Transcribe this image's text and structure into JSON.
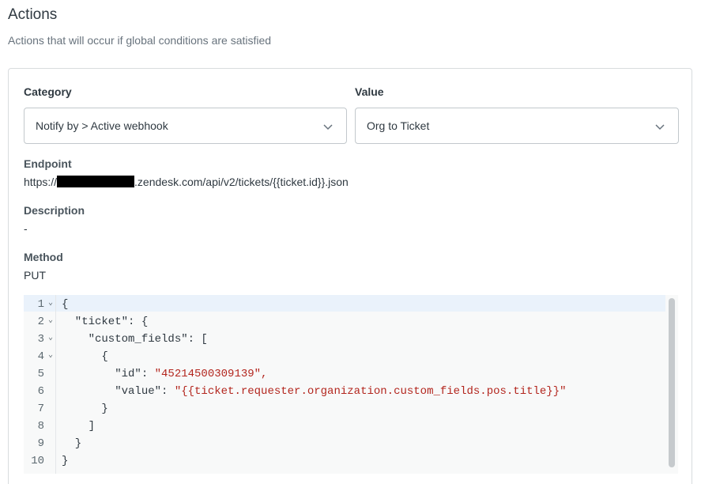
{
  "section": {
    "title": "Actions",
    "subtitle": "Actions that will occur if global conditions are satisfied"
  },
  "fields": {
    "category_label": "Category",
    "category_value": "Notify by > Active webhook",
    "value_label": "Value",
    "value_value": "Org to Ticket"
  },
  "details": {
    "endpoint_label": "Endpoint",
    "endpoint_prefix": "https://",
    "endpoint_suffix": ".zendesk.com/api/v2/tickets/{{ticket.id}}.json",
    "description_label": "Description",
    "description_value": "-",
    "method_label": "Method",
    "method_value": "PUT"
  },
  "editor": {
    "line_numbers": [
      "1",
      "2",
      "3",
      "4",
      "5",
      "6",
      "7",
      "8",
      "9",
      "10"
    ],
    "lines": [
      "{",
      "  \"ticket\": {",
      "    \"custom_fields\": [",
      "      {",
      "        \"id\": ",
      "        \"value\": ",
      "      }",
      "    ]",
      "  }",
      "}"
    ],
    "string_values": {
      "id_value": "\"45214500309139\",",
      "value_value": "\"{{ticket.requester.organization.custom_fields.pos.title}}\""
    }
  },
  "icons": {
    "select_chevron": "chevron-down-icon",
    "fold_marker": "fold-arrow-icon"
  },
  "colors": {
    "string": "#b3261e",
    "active_line": "#eaf2fb",
    "editor_bg": "#f8f9f9"
  }
}
